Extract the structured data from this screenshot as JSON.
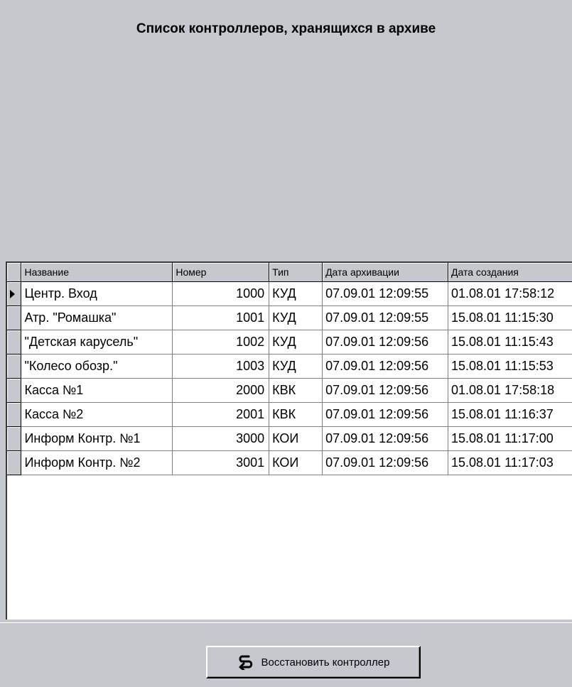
{
  "title": "Список контроллеров, хранящихся в архиве",
  "table": {
    "headers": [
      "Название",
      "Номер",
      "Тип",
      "Дата архивации",
      "Дата создания"
    ],
    "rows": [
      [
        "Центр. Вход",
        "1000",
        "КУД",
        "07.09.01 12:09:55",
        "01.08.01 17:58:12"
      ],
      [
        "Атр. \"Ромашка\"",
        "1001",
        "КУД",
        "07.09.01 12:09:55",
        "15.08.01 11:15:30"
      ],
      [
        "\"Детская карусель\"",
        "1002",
        "КУД",
        "07.09.01 12:09:56",
        "15.08.01 11:15:43"
      ],
      [
        "\"Колесо обозр.\"",
        "1003",
        "КУД",
        "07.09.01 12:09:56",
        "15.08.01 11:15:53"
      ],
      [
        "Касса №1",
        "2000",
        "КВК",
        "07.09.01 12:09:56",
        "01.08.01 17:58:18"
      ],
      [
        "Касса №2",
        "2001",
        "КВК",
        "07.09.01 12:09:56",
        "15.08.01 11:16:37"
      ],
      [
        "Информ Контр. №1",
        "3000",
        "КОИ",
        "07.09.01 12:09:56",
        "15.08.01 11:17:00"
      ],
      [
        "Информ Контр. №2",
        "3001",
        "КОИ",
        "07.09.01 12:09:56",
        "15.08.01 11:17:03"
      ]
    ],
    "selected_row": 0
  },
  "restore_button": {
    "label": "Восстановить контроллер",
    "icon": "restore-arrow-icon"
  }
}
